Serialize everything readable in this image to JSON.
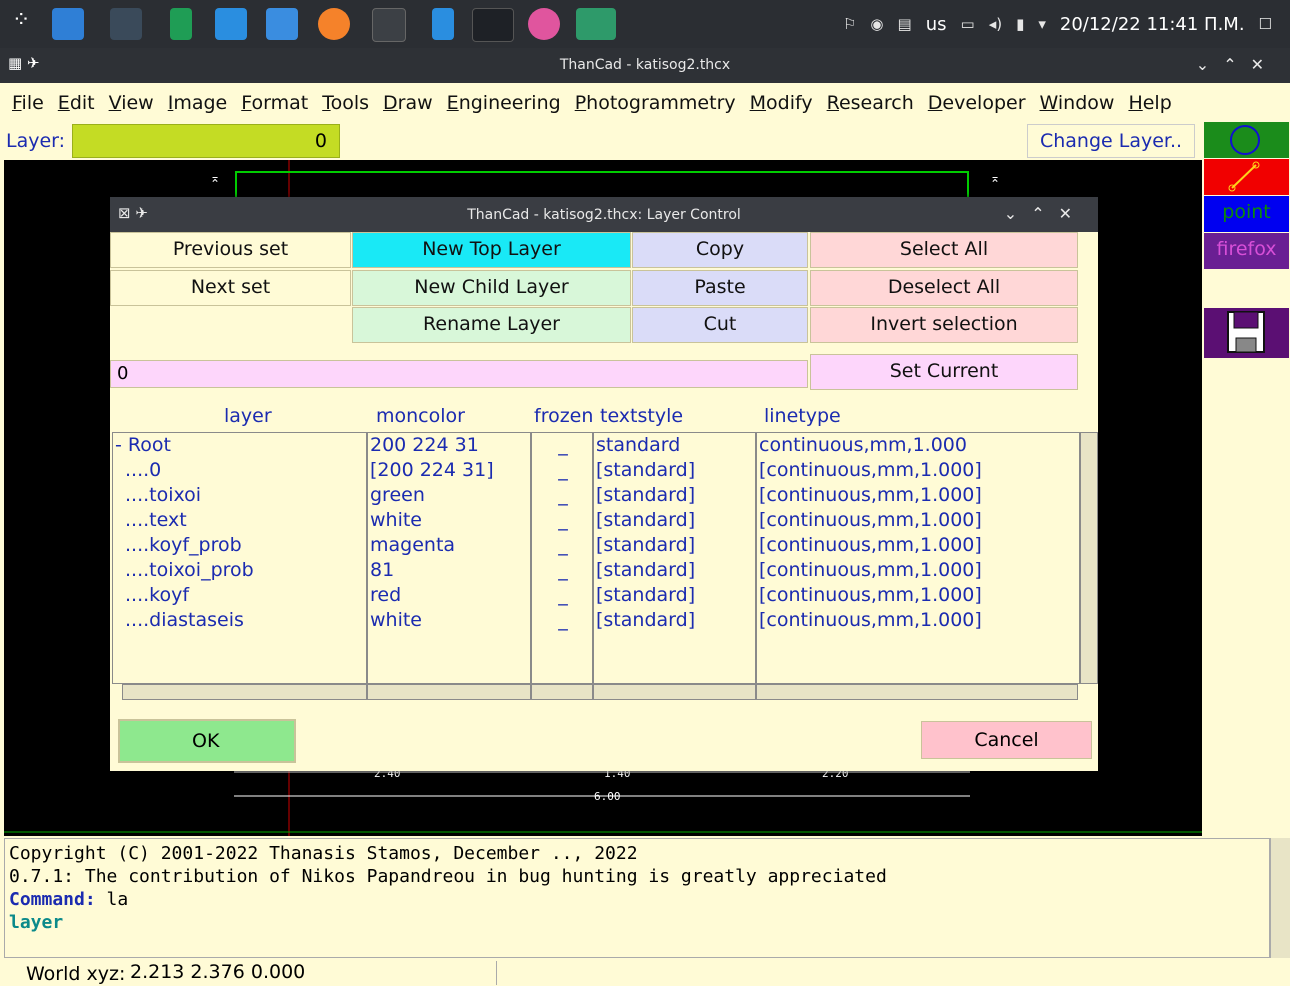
{
  "taskbar": {
    "tray": {
      "keyboard": "us",
      "datetime": "20/12/22 11:41 Π.Μ."
    }
  },
  "window": {
    "title": "ThanCad - katisog2.thcx"
  },
  "menu": [
    "File",
    "Edit",
    "View",
    "Image",
    "Format",
    "Tools",
    "Draw",
    "Engineering",
    "Photogrammetry",
    "Modify",
    "Research",
    "Developer",
    "Window",
    "Help"
  ],
  "layerbar": {
    "label": "Layer:",
    "value": "0",
    "change_button": "Change Layer.."
  },
  "right_tools": {
    "point": "point",
    "firefox": "firefox"
  },
  "drawing": {
    "dims": {
      "d1": "2.40",
      "d2": "1.40",
      "d3": "2.20",
      "total": "6.00"
    },
    "colors": {
      "green": "#00cc00",
      "red": "#cc0000",
      "white": "#ffffff"
    }
  },
  "dialog": {
    "title": "ThanCad - katisog2.thcx: Layer Control",
    "buttons": {
      "previous_set": "Previous set",
      "next_set": "Next set",
      "new_top_layer": "New Top Layer",
      "new_child_layer": "New Child Layer",
      "rename_layer": "Rename Layer",
      "copy": "Copy",
      "paste": "Paste",
      "cut": "Cut",
      "select_all": "Select All",
      "deselect_all": "Deselect All",
      "invert_selection": "Invert selection",
      "set_current": "Set Current",
      "ok": "OK",
      "cancel": "Cancel"
    },
    "current_value": "0",
    "columns": [
      "layer",
      "moncolor",
      "frozen",
      "textstyle",
      "linetype"
    ],
    "rows": [
      {
        "layer": "Root",
        "moncolor": "200 224 31",
        "frozen": "_",
        "textstyle": "standard",
        "linetype": "continuous,mm,1.000"
      },
      {
        "layer": "....0",
        "moncolor": "[200 224 31]",
        "frozen": "_",
        "textstyle": "[standard]",
        "linetype": "[continuous,mm,1.000]"
      },
      {
        "layer": "....toixoi",
        "moncolor": "green",
        "frozen": "_",
        "textstyle": "[standard]",
        "linetype": "[continuous,mm,1.000]"
      },
      {
        "layer": "....text",
        "moncolor": "white",
        "frozen": "_",
        "textstyle": "[standard]",
        "linetype": "[continuous,mm,1.000]"
      },
      {
        "layer": "....koyf_prob",
        "moncolor": "magenta",
        "frozen": "_",
        "textstyle": "[standard]",
        "linetype": "[continuous,mm,1.000]"
      },
      {
        "layer": "....toixoi_prob",
        "moncolor": "81",
        "frozen": "_",
        "textstyle": "[standard]",
        "linetype": "[continuous,mm,1.000]"
      },
      {
        "layer": "....koyf",
        "moncolor": "red",
        "frozen": "_",
        "textstyle": "[standard]",
        "linetype": "[continuous,mm,1.000]"
      },
      {
        "layer": "....diastaseis",
        "moncolor": "white",
        "frozen": "_",
        "textstyle": "[standard]",
        "linetype": "[continuous,mm,1.000]"
      }
    ]
  },
  "console": {
    "line1": "Copyright (C) 2001-2022 Thanasis Stamos, December .., 2022",
    "line2": "0.7.1: The contribution of Nikos Papandreou in bug hunting is greatly appreciated",
    "command_label": "Command:",
    "command_value": " la",
    "line4": "layer"
  },
  "status": {
    "label": "World xyz:",
    "value": "2.213 2.376 0.000"
  }
}
